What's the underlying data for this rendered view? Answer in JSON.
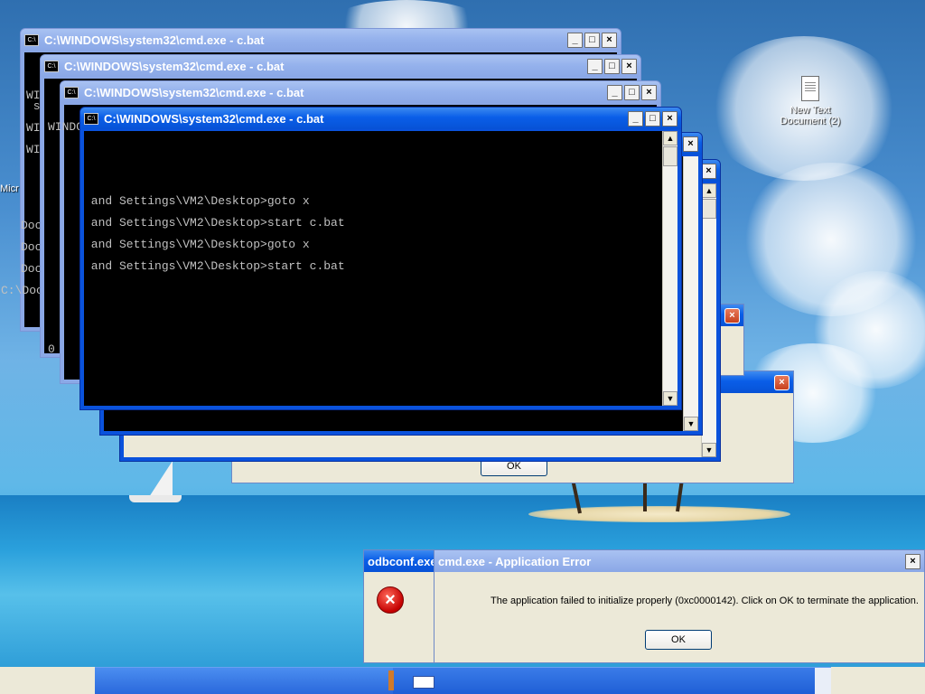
{
  "desktop": {
    "icon_label_1": "New Text",
    "icon_label_2": "Document (2)",
    "partial_label": "Micr"
  },
  "cmd_windows": [
    {
      "title": "C:\\WINDOWS\\system32\\cmd.exe - c.bat"
    },
    {
      "title": "C:\\WINDOWS\\system32\\cmd.exe - c.bat"
    },
    {
      "title": "C:\\WINDOWS\\system32\\cmd.exe - c.bat"
    },
    {
      "title": "C:\\WINDOWS\\system32\\cmd.exe - c.bat"
    }
  ],
  "console": {
    "lines": [
      " and Settings\\VM2\\Desktop>goto x",
      " and Settings\\VM2\\Desktop>start c.bat",
      " and Settings\\VM2\\Desktop>goto x",
      " and Settings\\VM2\\Desktop>start c.bat"
    ],
    "stub_left_1": "WIN",
    "stub_left_2": " sys",
    "stub_left_3": "WIN",
    "stub_left_4": "WIN",
    "stub_left_5": "WINDOWS",
    "stub_doc_1": "Documents",
    "stub_doc_2": "Documents",
    "stub_doc_3": "Documents",
    "stub_doc_4": "C:\\Documents",
    "stub_zero": "0"
  },
  "caption_buttons": {
    "minimize": "_",
    "maximize": "□",
    "close": "×"
  },
  "dialogs": {
    "back_ok": "OK",
    "odbc_title": "odbconf.exe",
    "app_error": {
      "title": "cmd.exe - Application Error",
      "message": "The application failed to initialize properly (0xc0000142). Click on OK to terminate the application.",
      "ok": "OK"
    }
  },
  "colors": {
    "accent": "#0a52dc",
    "console_bg": "#000000",
    "dialog_bg": "#ece9d8"
  }
}
